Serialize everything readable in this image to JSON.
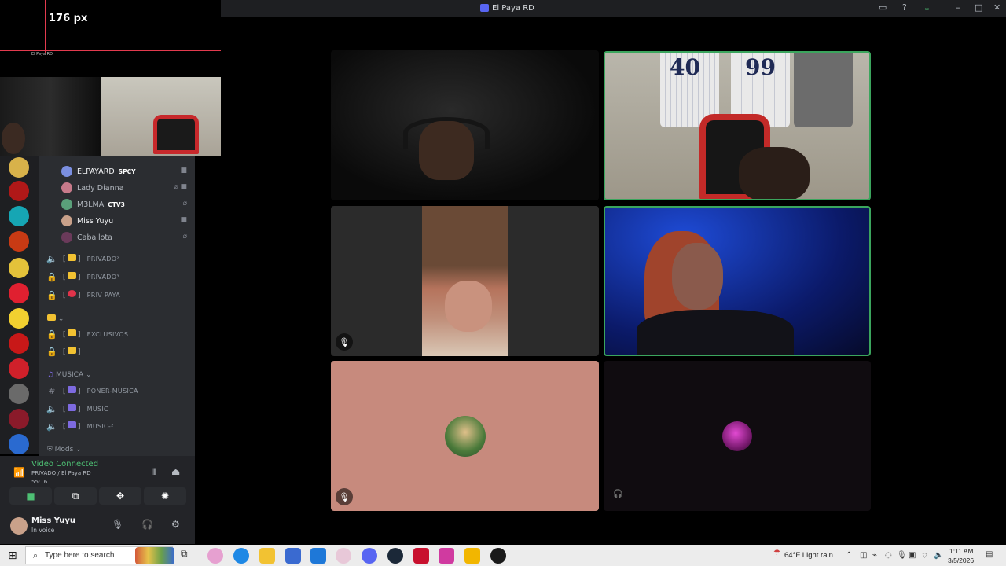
{
  "overlay": {
    "ruler_label": "176 px",
    "ruler_sub": "El Paya RD"
  },
  "window": {
    "title": "El Paya RD"
  },
  "servers": [
    {
      "color": "#d8b24a"
    },
    {
      "color": "#b01818"
    },
    {
      "color": "#16a6b4"
    },
    {
      "color": "#c83a14"
    },
    {
      "color": "#e4c23a"
    },
    {
      "color": "#e02030"
    },
    {
      "color": "#f2d030"
    },
    {
      "color": "#c81818"
    },
    {
      "color": "#d0202a"
    },
    {
      "color": "#6a6a6a"
    },
    {
      "color": "#8a1a2a"
    },
    {
      "color": "#2a6ad0"
    }
  ],
  "voice_users": [
    {
      "name": "ELPAYARD",
      "tag": "SPCY",
      "color": "#f2f3f5",
      "avatar": "#7b8fe0"
    },
    {
      "name": "Lady Dianna",
      "tag": "",
      "color": "#b5bac1",
      "avatar": "#c77a8a"
    },
    {
      "name": "M3LMA",
      "tag": "CTV3",
      "color": "#b5bac1",
      "avatar": "#5aa07a"
    },
    {
      "name": "Miss Yuyu",
      "tag": "",
      "color": "#f2f3f5",
      "avatar": "#c9a18a"
    },
    {
      "name": "Caballota",
      "tag": "",
      "color": "#b5bac1",
      "avatar": "#6a3a5a"
    }
  ],
  "channels_priv": [
    {
      "name": "PRIVADO²"
    },
    {
      "name": "PRIVADO³"
    },
    {
      "name": "PRIV PAYA"
    }
  ],
  "channels_excl": [
    {
      "name": "EXCLUSIVOS"
    },
    {
      "name": ""
    }
  ],
  "category_musica": "MUSICA",
  "channels_music": [
    {
      "name": "PONER-MUSICA"
    },
    {
      "name": "MUSIC"
    },
    {
      "name": "MUSIC-²"
    }
  ],
  "category_mods": "Mods",
  "voice_panel": {
    "status": "Video Connected",
    "channel": "PRIVADO / El Paya RD",
    "time": "55:16"
  },
  "user": {
    "name": "Miss Yuyu",
    "status": "In voice"
  },
  "taskbar": {
    "search_placeholder": "Type here to search",
    "weather": "64°F  Light rain",
    "time": "1:11 AM",
    "date": "3/5/2026"
  },
  "colors": {
    "speaking_border": "#3ba55d",
    "accent": "#5865f2",
    "ruler": "#e23a4e"
  }
}
